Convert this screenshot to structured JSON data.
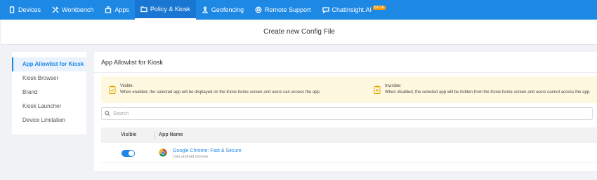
{
  "topnav": {
    "items": [
      {
        "label": "Devices",
        "icon": "device-icon"
      },
      {
        "label": "Workbench",
        "icon": "tools-icon"
      },
      {
        "label": "Apps",
        "icon": "apps-icon"
      },
      {
        "label": "Policy & Kiosk",
        "icon": "folder-icon",
        "active": true
      },
      {
        "label": "Geofencing",
        "icon": "geofence-icon"
      },
      {
        "label": "Remote Support",
        "icon": "remote-support-icon"
      },
      {
        "label": "ChatInsight.AI",
        "icon": "chat-icon",
        "badge": "BETA"
      }
    ]
  },
  "page": {
    "title": "Create new Config File"
  },
  "sidebar": {
    "items": [
      {
        "label": "App Allowlist for Kiosk",
        "active": true
      },
      {
        "label": "Kiosk Browser"
      },
      {
        "label": "Brand"
      },
      {
        "label": "Kiosk Launcher"
      },
      {
        "label": "Device Limitation"
      }
    ]
  },
  "main": {
    "title": "App Allowlist for Kiosk",
    "info": {
      "visible": {
        "heading": "Visible:",
        "text": "When enabled, the selected app will be displayed on the Kiosk home screen and users can access the app."
      },
      "invisible": {
        "heading": "Invisible:",
        "text": "When disabled, the selected app will be hidden from the Kiosk home screen and users cannot access the app."
      }
    },
    "search": {
      "placeholder": "Search"
    },
    "table": {
      "columns": [
        "Visible",
        "App Name"
      ],
      "rows": [
        {
          "visible": true,
          "name": "Google Chrome: Fast & Secure",
          "package": "com.android.chrome",
          "icon": "chrome-icon"
        }
      ]
    }
  },
  "colors": {
    "accent": "#1e88e5",
    "info_bg": "#fff8e1",
    "beta": "#ff9800"
  }
}
